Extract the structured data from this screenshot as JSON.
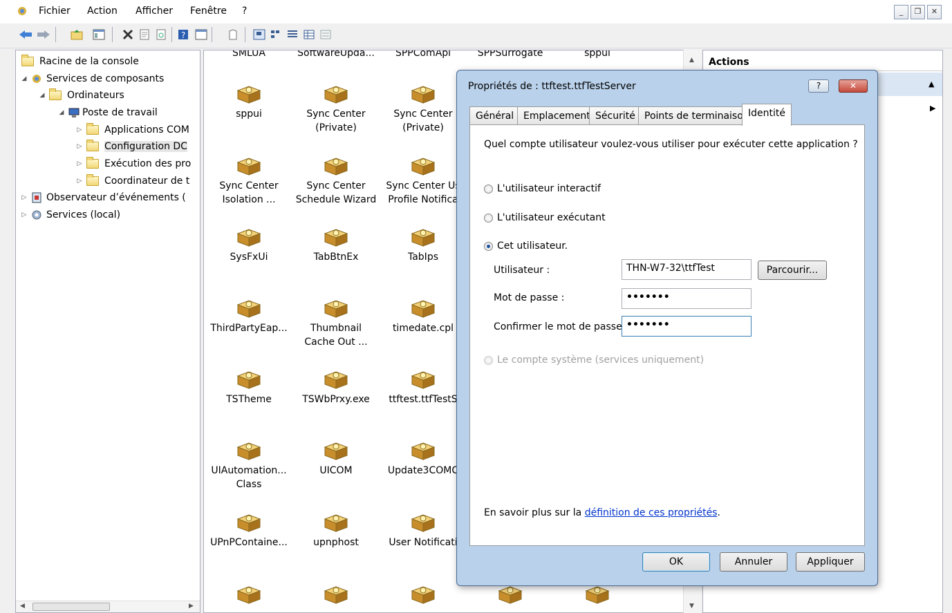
{
  "menubar": {
    "items": [
      "Fichier",
      "Action",
      "Afficher",
      "Fenêtre",
      "?"
    ]
  },
  "tree": {
    "items": [
      {
        "label": "Racine de la console"
      },
      {
        "label": "Services de composants"
      },
      {
        "label": "Ordinateurs"
      },
      {
        "label": "Poste de travail"
      },
      {
        "label": "Applications COM"
      },
      {
        "label": "Configuration DC"
      },
      {
        "label": "Exécution des pro"
      },
      {
        "label": "Coordinateur de t"
      },
      {
        "label": "Observateur d’événements ("
      },
      {
        "label": "Services (local)"
      }
    ]
  },
  "grid": {
    "top_labels": [
      "SMLUA",
      "SoftwareUpda...",
      "SPPComApi",
      "SPPSurrogate",
      "sppui"
    ],
    "items": [
      {
        "line1": "sppui",
        "line2": ""
      },
      {
        "line1": "Sync Center",
        "line2": "(Private)"
      },
      {
        "line1": "Sync Center",
        "line2": "(Private)"
      },
      {
        "line1": "Sync Center",
        "line2": "Isolation ..."
      },
      {
        "line1": "Sync Center",
        "line2": "Schedule Wizard"
      },
      {
        "line1": "Sync Center Us",
        "line2": "Profile Notifica"
      },
      {
        "line1": "SysFxUi",
        "line2": ""
      },
      {
        "line1": "TabBtnEx",
        "line2": ""
      },
      {
        "line1": "TabIps",
        "line2": ""
      },
      {
        "line1": "ThirdPartyEap...",
        "line2": ""
      },
      {
        "line1": "Thumbnail",
        "line2": "Cache Out ..."
      },
      {
        "line1": "timedate.cpl",
        "line2": ""
      },
      {
        "line1": "TSTheme",
        "line2": ""
      },
      {
        "line1": "TSWbPrxy.exe",
        "line2": ""
      },
      {
        "line1": "ttftest.ttfTestS",
        "line2": ""
      },
      {
        "line1": "UIAutomation...",
        "line2": "Class"
      },
      {
        "line1": "UICOM",
        "line2": ""
      },
      {
        "line1": "Update3COMC",
        "line2": ""
      },
      {
        "line1": "UPnPContaine...",
        "line2": ""
      },
      {
        "line1": "upnphost",
        "line2": ""
      },
      {
        "line1": "User Notificati",
        "line2": ""
      }
    ]
  },
  "actions": {
    "title": "Actions"
  },
  "dialog": {
    "title": "Propriétés de : ttftest.ttfTestServer",
    "tabs": [
      "Général",
      "Emplacement",
      "Sécurité",
      "Points de terminaison",
      "Identité"
    ],
    "question": "Quel compte utilisateur voulez-vous utiliser pour exécuter cette application ?",
    "radio_interactive": "L'utilisateur interactif",
    "radio_launching": "L'utilisateur exécutant",
    "radio_this_user": "Cet utilisateur.",
    "label_user": "Utilisateur :",
    "value_user": "THN-W7-32\\ttfTest",
    "browse": "Parcourir...",
    "label_password": "Mot de passe :",
    "value_password": "•••••••",
    "label_confirm": "Confirmer le mot de passe :",
    "value_confirm": "•••••••",
    "radio_system": "Le compte système (services uniquement)",
    "learn_prefix": "En savoir plus sur la ",
    "learn_link": "définition de ces propriétés",
    "learn_suffix": ".",
    "ok": "OK",
    "cancel": "Annuler",
    "apply": "Appliquer"
  },
  "colors": {
    "accent": "#0033cc",
    "dialog_frame": "#b9d1ea",
    "close_button": "#c74a3c"
  }
}
